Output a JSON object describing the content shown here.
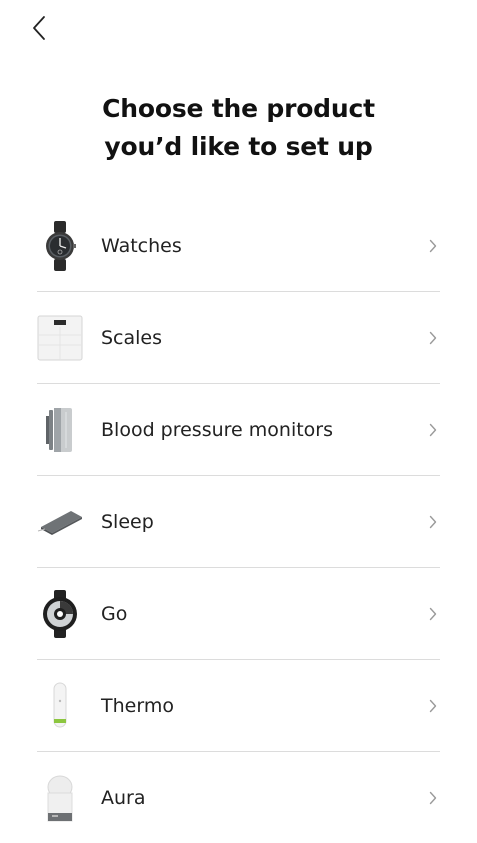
{
  "header": {
    "back_icon": "chevron-left-icon",
    "title_line1": "Choose the product",
    "title_line2": "you’d like to set up"
  },
  "products": [
    {
      "label": "Watches",
      "icon": "watch-icon"
    },
    {
      "label": "Scales",
      "icon": "scale-icon"
    },
    {
      "label": "Blood pressure monitors",
      "icon": "blood-pressure-monitor-icon"
    },
    {
      "label": "Sleep",
      "icon": "sleep-mat-icon"
    },
    {
      "label": "Go",
      "icon": "activity-tracker-icon"
    },
    {
      "label": "Thermo",
      "icon": "thermometer-icon"
    },
    {
      "label": "Aura",
      "icon": "aura-lamp-icon"
    }
  ],
  "colors": {
    "divider": "#dcdcdc",
    "chevron": "#9a9a9a",
    "text": "#222222"
  }
}
